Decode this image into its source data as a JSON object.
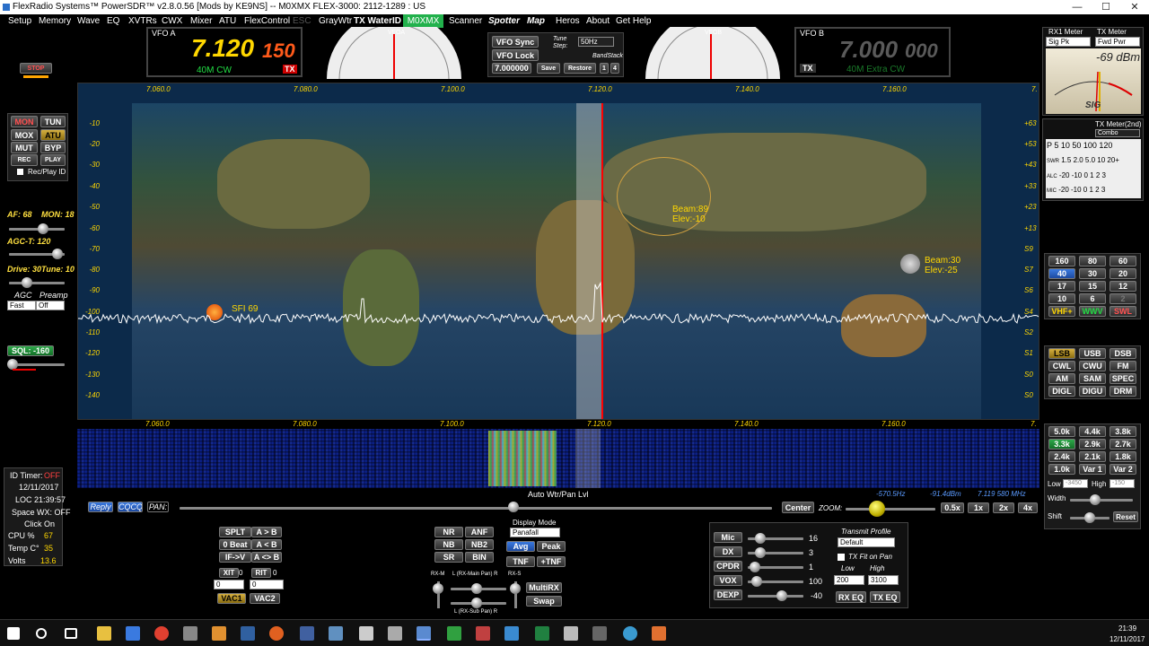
{
  "window": {
    "title": "FlexRadio Systems™  PowerSDR™ v2.8.0.56  [Mods by KE9NS]  --  M0XMX  FLEX-3000: 2112-1289 : US",
    "minimize": "—",
    "maximize": "☐",
    "close": "✕"
  },
  "menu": [
    "Setup",
    "Memory",
    "Wave",
    "EQ",
    "XVTRs",
    "CWX",
    "Mixer",
    "ATU",
    "FlexControl",
    "ESC",
    "GrayWtr",
    "TX WaterID",
    "M0XMX",
    "Scanner",
    "Spotter",
    "Map",
    "Heros",
    "About",
    "Get Help"
  ],
  "left": {
    "stop": "STOP",
    "buttons": [
      "MON",
      "TUN",
      "MOX",
      "ATU",
      "MUT",
      "BYP",
      "REC",
      "PLAY"
    ],
    "rec_play_id": "Rec/Play ID",
    "af": "AF: 68",
    "mon": "MON: 18",
    "agc_t": "AGC-T: 120",
    "drive": "Drive: 30",
    "tune": "Tune: 10",
    "agc": "AGC",
    "preamp": "Preamp",
    "agc_val": "Fast",
    "preamp_val": "Off",
    "sql": "SQL: -160"
  },
  "status": {
    "id_timer_label": "ID Timer:",
    "id_timer": "OFF",
    "date": "12/11/2017",
    "loc": "LOC  21:39:57",
    "space_wx": "Space WX: OFF",
    "click_on": "Click On",
    "cpu_label": "CPU %",
    "cpu": "67",
    "temp_label": "Temp C°",
    "temp": "35",
    "volts_label": "Volts",
    "volts": "13.6"
  },
  "vfo_a": {
    "label": "VFO A",
    "freq_main": "7.120",
    "freq_sub": "150",
    "mode": "40M CW",
    "tx": "TX"
  },
  "vfo_b": {
    "label": "VFO B",
    "freq_main": "7.000",
    "freq_sub": "000",
    "mode": "40M Extra CW",
    "tx": "TX"
  },
  "vfo_center": {
    "sync": "VFO Sync",
    "lock": "VFO Lock",
    "tune_step_label": "Tune Step:",
    "tune_step": "50Hz",
    "bandstack": "BandStack",
    "memfreq": "7.000000",
    "save": "Save",
    "restore": "Restore",
    "b1": "1",
    "b2": "4"
  },
  "gauge_labels": {
    "a": "VFOA",
    "b": "VFOB"
  },
  "meters": {
    "rx1": "RX1 Meter",
    "tx": "TX Meter",
    "rx_sel": "Sig Pk",
    "tx_sel": "Fwd Pwr",
    "dbm": "-69 dBm",
    "sig": "SIG",
    "tx2nd": "TX Meter(2nd)",
    "combo": "Combo",
    "rows": [
      {
        "k": "P",
        "v": "5  10   50    100 120"
      },
      {
        "k": "SWR",
        "v": "1.5  2.0  5.0  10  20+"
      },
      {
        "k": "ALC",
        "v": "-20   -10    0  1 2 3"
      },
      {
        "k": "MIC",
        "v": "-20   -10    0  1 2 3"
      }
    ]
  },
  "bands": [
    "160",
    "80",
    "60",
    "40",
    "30",
    "20",
    "17",
    "15",
    "12",
    "10",
    "6",
    "2",
    "VHF+",
    "WWV",
    "SWL"
  ],
  "modes": [
    "LSB",
    "USB",
    "DSB",
    "CWL",
    "CWU",
    "FM",
    "AM",
    "SAM",
    "SPEC",
    "DIGL",
    "DIGU",
    "DRM"
  ],
  "filters": [
    "5.0k",
    "4.4k",
    "3.8k",
    "3.3k",
    "2.9k",
    "2.7k",
    "2.4k",
    "2.1k",
    "1.8k",
    "1.0k",
    "Var 1",
    "Var 2"
  ],
  "filter_ctrl": {
    "low": "Low",
    "low_val": "-3450",
    "high": "High",
    "high_val": "-150",
    "width": "Width",
    "shift": "Shift",
    "reset": "Reset"
  },
  "spectrum": {
    "x_ticks": [
      "7.060.0",
      "7.080.0",
      "7.100.0",
      "7.120.0",
      "7.140.0",
      "7.160.0",
      "7."
    ],
    "y_ticks": [
      "-10",
      "-20",
      "-30",
      "-40",
      "-50",
      "-60",
      "-70",
      "-80",
      "-90",
      "-100",
      "-110",
      "-120",
      "-130",
      "-140"
    ],
    "s_ticks": [
      "+63",
      "+53",
      "+43",
      "+33",
      "+23",
      "+13",
      "S9",
      "S7",
      "S6",
      "S4",
      "S2",
      "S1",
      "S0",
      "S0"
    ],
    "sfi": "SFI 69",
    "beam1": "Beam:89",
    "elev1": "Elev:-10",
    "beam2": "Beam:30",
    "elev2": "Elev:-25"
  },
  "waterfall": {
    "x_ticks": [
      "7.060.0",
      "7.080.0",
      "7.100.0",
      "7.120.0",
      "7.140.0",
      "7.160.0",
      "7."
    ],
    "label": "Auto Wtr/Pan Lvl"
  },
  "bottom": {
    "reply": "Reply",
    "cqcq": "CQCQ",
    "pan": "PAN:",
    "center": "Center",
    "zoom": "ZOOM:",
    "offset": "-570.5Hz",
    "dbm": "-91.4dBm",
    "mhz": "7.119 580 MHz",
    "zooms": [
      "0.5x",
      "1x",
      "2x",
      "4x"
    ]
  },
  "rit": {
    "splt": "SPLT",
    "atob": "A > B",
    "zbeat": "0 Beat",
    "acb": "A < B",
    "ifv": "IF->V",
    "aswap": "A <> B",
    "xit": "XIT",
    "xit_v": "0",
    "rit": "RIT",
    "rit_v": "0",
    "xit_val": "0",
    "rit_val": "0",
    "vac1": "VAC1",
    "vac2": "VAC2"
  },
  "dsp": {
    "nr": "NR",
    "anf": "ANF",
    "nb": "NB",
    "nb2": "NB2",
    "sr": "SR",
    "bin": "BIN",
    "display_mode": "Display Mode",
    "display_val": "Panafall",
    "avg": "Avg",
    "peak": "Peak",
    "tnf": "TNF",
    "ptnf": "+TNF",
    "rxm": "RX-M",
    "rxs": "RX-S",
    "mainpan": "L (RX-Main Pan) R",
    "subpan": "L (RX-Sub Pan) R",
    "multirx": "MultiRX",
    "swap": "Swap"
  },
  "tx": {
    "mic": "Mic",
    "mic_v": "16",
    "dx": "DX",
    "dx_v": "3",
    "cpdr": "CPDR",
    "cpdr_v": "1",
    "vox": "VOX",
    "vox_v": "100",
    "dexp": "DEXP",
    "dexp_v": "-40",
    "profile": "Transmit Profile",
    "profile_val": "Default",
    "fit": "TX Fit on Pan",
    "low": "Low",
    "high": "High",
    "low_val": "200",
    "high_val": "3100",
    "rxeq": "RX EQ",
    "txeq": "TX EQ"
  },
  "taskbar": {
    "time": "21:39",
    "date": "12/11/2017"
  },
  "colors": {
    "accent": "#ffd700",
    "signal": "#ffffff",
    "tx_line": "#ff0000",
    "green": "#22b14c"
  }
}
